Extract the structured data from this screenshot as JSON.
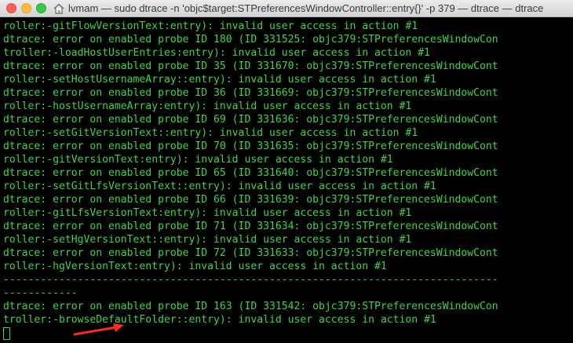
{
  "window": {
    "title": "lvmam — sudo dtrace -n 'objc$target:STPreferencesWindowController::entry{}' -p 379 — dtrace — dtrace"
  },
  "colors": {
    "terminal_text": "#42d24d",
    "background": "#000000",
    "annotation_arrow": "#ff2a1a"
  },
  "terminal": {
    "lines": [
      "roller:-gitFlowVersionText:entry): invalid user access in action #1",
      "dtrace: error on enabled probe ID 180 (ID 331525: objc379:STPreferencesWindowCon",
      "troller:-loadHostUserEntries:entry): invalid user access in action #1",
      "dtrace: error on enabled probe ID 35 (ID 331670: objc379:STPreferencesWindowCont",
      "roller:-setHostUsernameArray::entry): invalid user access in action #1",
      "dtrace: error on enabled probe ID 36 (ID 331669: objc379:STPreferencesWindowCont",
      "roller:-hostUsernameArray:entry): invalid user access in action #1",
      "dtrace: error on enabled probe ID 69 (ID 331636: objc379:STPreferencesWindowCont",
      "roller:-setGitVersionText::entry): invalid user access in action #1",
      "dtrace: error on enabled probe ID 70 (ID 331635: objc379:STPreferencesWindowCont",
      "roller:-gitVersionText:entry): invalid user access in action #1",
      "dtrace: error on enabled probe ID 65 (ID 331640: objc379:STPreferencesWindowCont",
      "roller:-setGitLfsVersionText::entry): invalid user access in action #1",
      "dtrace: error on enabled probe ID 66 (ID 331639: objc379:STPreferencesWindowCont",
      "roller:-gitLfsVersionText:entry): invalid user access in action #1",
      "dtrace: error on enabled probe ID 71 (ID 331634: objc379:STPreferencesWindowCont",
      "roller:-setHgVersionText::entry): invalid user access in action #1",
      "dtrace: error on enabled probe ID 72 (ID 331633: objc379:STPreferencesWindowCont",
      "roller:-hgVersionText:entry): invalid user access in action #1",
      "--------------------------------------------------------------------------------",
      "------------",
      "dtrace: error on enabled probe ID 163 (ID 331542: objc379:STPreferencesWindowCon",
      "troller:-browseDefaultFolder::entry): invalid user access in action #1"
    ]
  }
}
